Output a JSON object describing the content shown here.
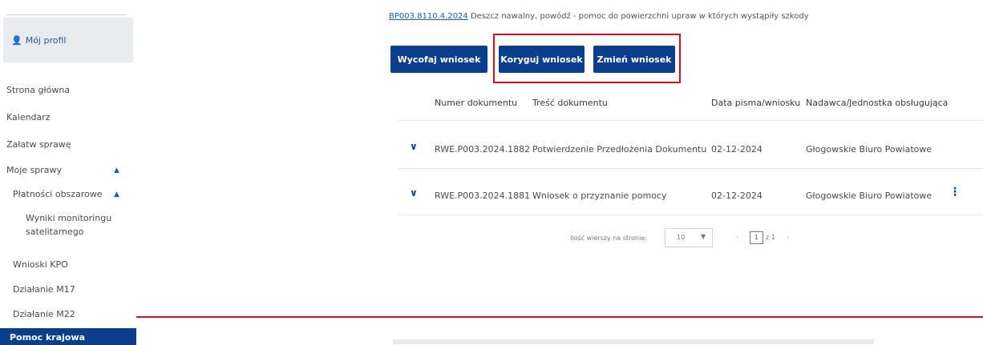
{
  "sidebar": {
    "profile": {
      "icon": "user-icon",
      "label": "Mój profil"
    },
    "items": [
      {
        "label": "Strona główna"
      },
      {
        "label": "Kalendarz"
      },
      {
        "label": "Załatw sprawę"
      },
      {
        "label": "Moje sprawy"
      },
      {
        "label": "Płatności obszarowe"
      },
      {
        "label": "Wyniki monitoringu"
      },
      {
        "label": "satelitarnego"
      },
      {
        "label": "Wnioski KPO"
      },
      {
        "label": "Działanie M17"
      },
      {
        "label": "Działanie M22"
      },
      {
        "label": "Pomoc krajowa"
      }
    ]
  },
  "header": {
    "case_link": "BP003.8110.4.2024",
    "case_desc": " Deszcz nawalny, powódź - pomoc do powierzchni upraw w których wystąpiły szkody"
  },
  "actions": {
    "withdraw": "Wycofaj wniosek",
    "correct": "Koryguj wniosek",
    "change": "Zmień wniosek"
  },
  "table": {
    "columns": [
      "Numer dokumentu",
      "Treść dokumentu",
      "Data pisma/wniosku",
      "Nadawca/Jednostka obsługująca"
    ],
    "rows": [
      {
        "number": "RWE.P003.2024.1882",
        "content": "Potwierdzenie Przedłożenia Dokumentu",
        "date": "02-12-2024",
        "sender": "Głogowskie Biuro Powiatowe"
      },
      {
        "number": "RWE.P003.2024.1881",
        "content": "Wniosek o przyznanie pomocy",
        "date": "02-12-2024",
        "sender": "Głogowskie Biuro Powiatowe"
      }
    ]
  },
  "pagination": {
    "rows_label": "Ilość wierszy na stronie:",
    "rows_value": "10",
    "page": "1",
    "of": "z 1"
  },
  "colors": {
    "primary": "#0b3f8e",
    "highlight": "#d5111b"
  }
}
